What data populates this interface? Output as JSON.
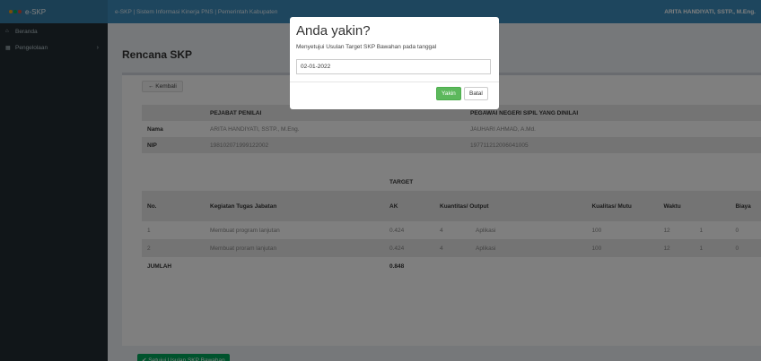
{
  "brand": {
    "name": "e-SKP",
    "dot_colors": [
      "#f39c12",
      "#00a65a",
      "#dd4b39"
    ]
  },
  "sidebar": {
    "items": [
      {
        "icon": "home-icon",
        "label": "Beranda"
      },
      {
        "icon": "grid-icon",
        "label": "Pengelolaan",
        "chevron": "›"
      }
    ]
  },
  "topbar": {
    "title": "e-SKP | Sistem Informasi Kinerja PNS | Pemerintah Kabupaten",
    "user": "ARITA HANDIYATI, SSTP., M.Eng."
  },
  "page": {
    "title": "Rencana SKP",
    "back_label": "← Kembali",
    "approve_label": "✔ Setujui Usulan SKP Bawahan"
  },
  "people": {
    "col_penilai": "PEJABAT PENILAI",
    "col_dinilai": "PEGAWAI NEGERI SIPIL YANG DINILAI",
    "rows": [
      {
        "label": "Nama",
        "penilai": "ARITA HANDIYATI, SSTP., M.Eng.",
        "dinilai": "JAUHARI AHMAD, A.Md."
      },
      {
        "label": "NIP",
        "penilai": "198102071999122002",
        "dinilai": "197711212006041005"
      }
    ]
  },
  "targets": {
    "group_header": "TARGET",
    "headers": {
      "no": "No.",
      "kegiatan": "Kegiatan Tugas Jabatan",
      "ak": "AK",
      "kuantitas": "Kuantitas/ Output",
      "kualitas": "Kualitas/ Mutu",
      "waktu": "Waktu",
      "biaya": "Biaya"
    },
    "rows": [
      {
        "no": "1",
        "kegiatan": "Membuat program lanjutan",
        "ak": "0.424",
        "qty": "4",
        "output": "Aplikasi",
        "mutu": "100",
        "waktu": "12",
        "waktu_unit": "1",
        "biaya": "0"
      },
      {
        "no": "2",
        "kegiatan": "Membuat proram lanjutan",
        "ak": "0.424",
        "qty": "4",
        "output": "Aplikasi",
        "mutu": "100",
        "waktu": "12",
        "waktu_unit": "1",
        "biaya": "0"
      }
    ],
    "total_label": "JUMLAH",
    "total_ak": "0.848"
  },
  "modal": {
    "title": "Anda yakin?",
    "message": "Menyetujui Usulan Target SKP Bawahan pada tanggal",
    "date_value": "02-01-2022",
    "yes_label": "Yakin",
    "no_label": "Batal"
  }
}
